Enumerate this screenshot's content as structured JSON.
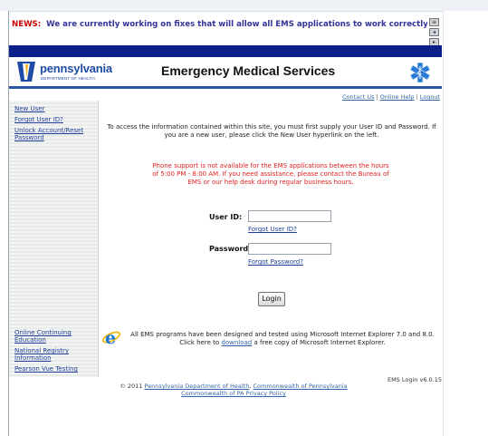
{
  "news": {
    "label": "NEWS:",
    "text": "We are currently working on fixes that will allow all EMS applications to work correctly on all bro"
  },
  "header": {
    "logo_name": "pennsylvania",
    "logo_sub": "DEPARTMENT OF HEALTH",
    "title": "Emergency Medical Services"
  },
  "top_links": {
    "contact": "Contact Us",
    "sep": "|",
    "help": "Online Help",
    "logout": "Logout"
  },
  "sidebar": {
    "top_links": [
      "New User",
      "Forgot User ID?",
      "Unlock Account/Reset Password"
    ],
    "bottom_links": [
      "Online Continuing Education",
      "National Registry Information",
      "Pearson Vue Testing"
    ]
  },
  "main": {
    "intro": "To access the information contained within this site, you must first supply your User ID and Password. If you are a new user, please click the New User hyperlink on the left.",
    "phone_notice": "Phone support is not available for the EMS applications between the hours of 5:00 PM - 8:00 AM. If you need assistance, please contact the Bureau of EMS or our help desk during regular business hours.",
    "user_id_label": "User ID:",
    "user_id_value": "",
    "forgot_user_id": "Forgot User ID?",
    "password_label": "Password:",
    "password_value": "",
    "forgot_password": "Forgot Password?",
    "login_button": "Login",
    "ie_note_1": "All EMS programs have been designed and tested using Microsoft Internet Explorer 7.0 and 8.0.",
    "ie_note_2a": "Click here to",
    "ie_note_2_link": "download",
    "ie_note_2b": "a free copy of Microsoft Internet Explorer."
  },
  "footer": {
    "version": "EMS Login v6.0.15",
    "copyright": "© 2011",
    "link_doh": "Pennsylvania Department of Health",
    "comma": ",",
    "link_commonwealth": "Commonwealth of Pennsylvania",
    "link_privacy": "Commonwealth of PA Privacy Policy"
  },
  "colors": {
    "news_label": "#cc0000",
    "news_text": "#333399",
    "navy_band": "#0a1f8a",
    "brand_blue": "#1f4aa5",
    "phone_notice": "#e02020"
  },
  "icons": [
    "pa-keystone-logo",
    "star-of-life-icon",
    "internet-explorer-icon",
    "news-nav-icon"
  ]
}
